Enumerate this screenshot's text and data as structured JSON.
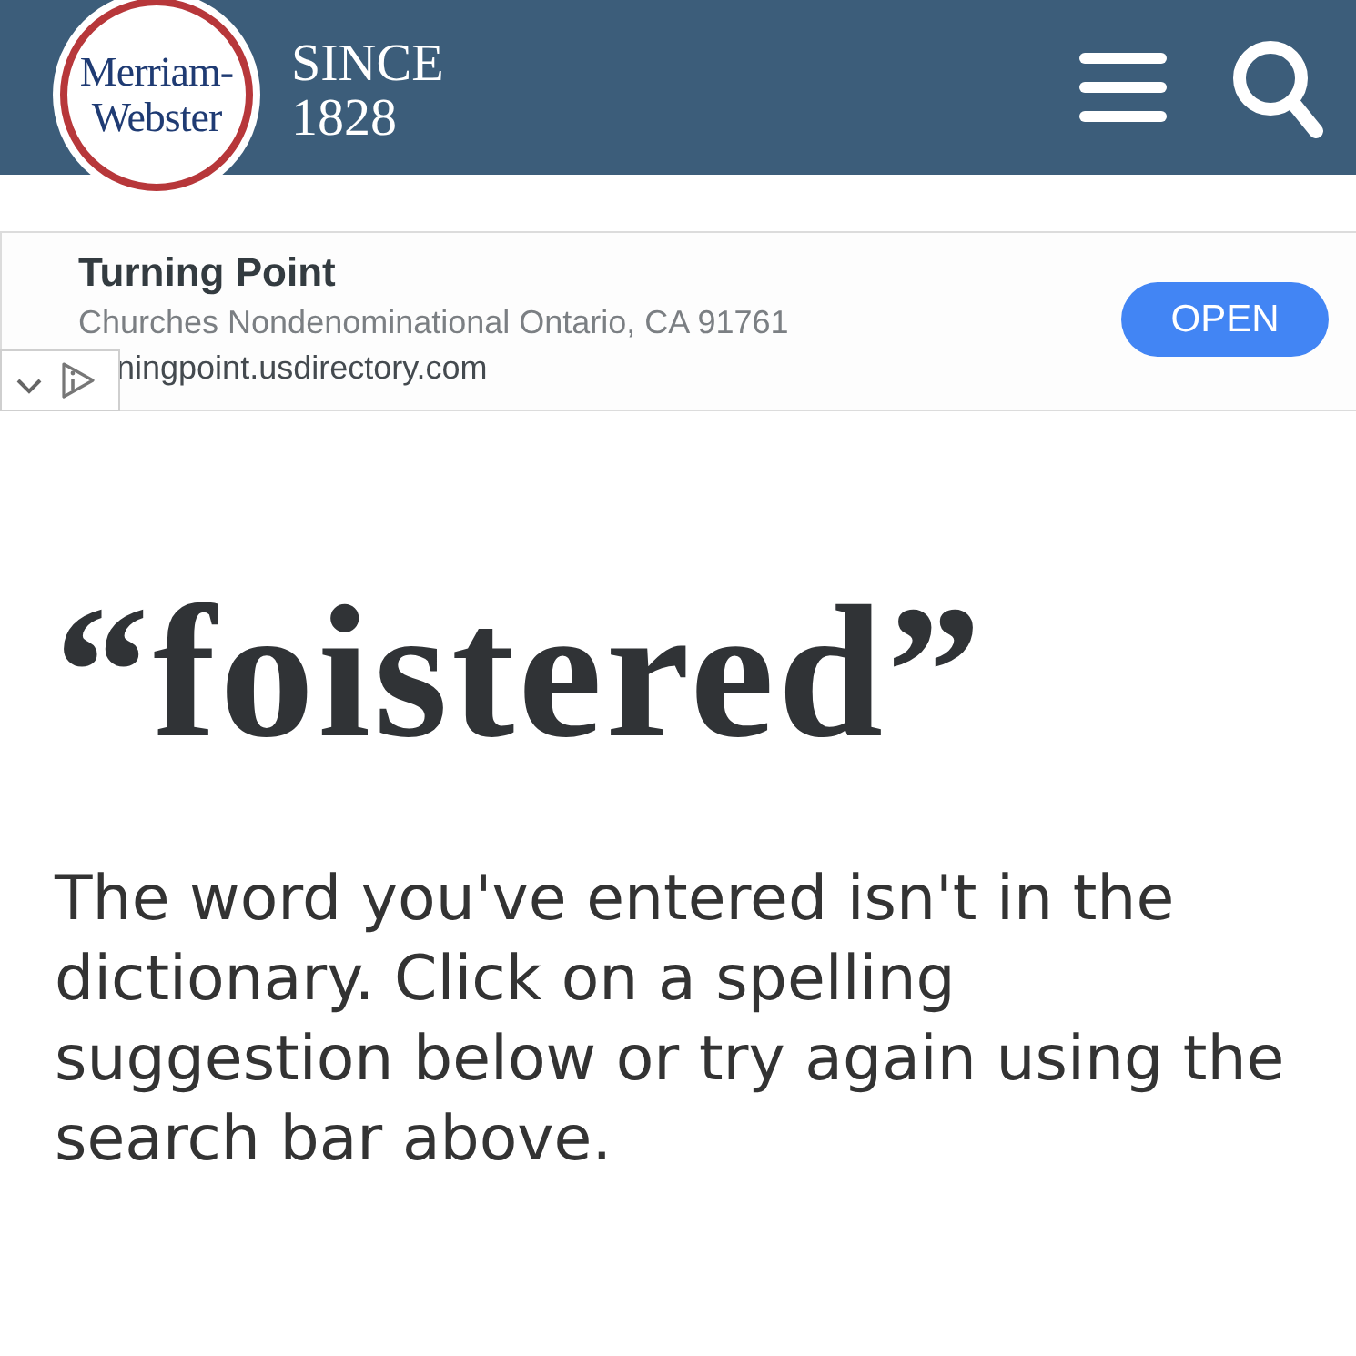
{
  "header": {
    "logo": {
      "lines": [
        "Merriam-",
        "Webster"
      ]
    },
    "tagline": {
      "lines": [
        "SINCE",
        "1828"
      ]
    }
  },
  "ad": {
    "title": "Turning Point",
    "subtitle": "Churches Nondenominational Ontario, CA 91761",
    "url": "ningpoint.usdirectory.com",
    "button": "OPEN"
  },
  "headword": "“foistered”",
  "message": "The word you've entered isn't in the dictionary. Click on a spelling suggestion below or try again using the search bar above."
}
